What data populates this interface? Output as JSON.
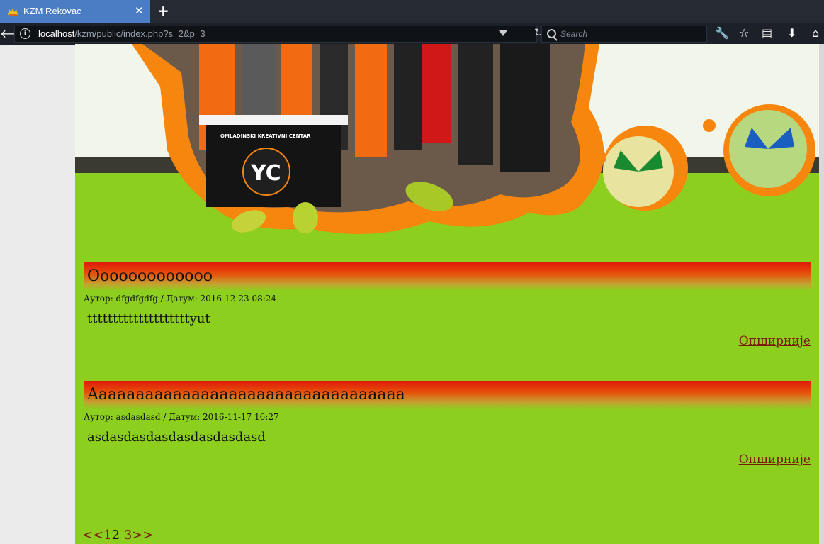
{
  "browser": {
    "tab_title": "KZM Rekovac",
    "url_host": "localhost",
    "url_path": "/kzm/public/index.php?s=2&p=3",
    "search_placeholder": "Search"
  },
  "banner": {
    "stand_text": "OMLADINSKI KREATIVNI CENTAR",
    "logo_text": "YC"
  },
  "posts": [
    {
      "title": "Ooooooooooooo",
      "meta": "Аутор: dfgdfgdfg / Датум: 2016-12-23 08:24",
      "excerpt": "ttttttttttttttttttttyut",
      "more": "Опширније"
    },
    {
      "title": "Aaaaaaaaaaaaaaaaaaaaaaaaaaaaaaaaaa",
      "meta": "Аутор: asdasdasd / Датум: 2016-11-17 16:27",
      "excerpt": "asdasdasdasdasdasdasdasd",
      "more": "Опширније"
    }
  ],
  "pagination": {
    "prev": "<<1",
    "current": "2",
    "next": "3>>"
  },
  "colors": {
    "page_bg": "#8ccf1e",
    "title_red": "#e01a0a",
    "link": "#7a1a0a",
    "tab_active": "#4a7dc3"
  }
}
